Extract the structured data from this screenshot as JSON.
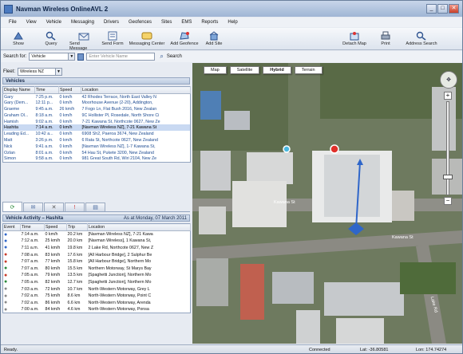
{
  "window": {
    "title": "Navman Wireless OnlineAVL 2"
  },
  "menu": [
    "File",
    "View",
    "Vehicle",
    "Messaging",
    "Drivers",
    "Geofences",
    "Sites",
    "EMS",
    "Reports",
    "Help"
  ],
  "toolbar": {
    "show": "Show",
    "query": "Query",
    "send_message": "Send Message",
    "send_form": "Send Form",
    "messaging_center": "Messaging Center",
    "add_geofence": "Add Geofence",
    "add_site": "Add Site",
    "detach_map": "Detach Map",
    "print": "Print",
    "address_search": "Address Search"
  },
  "search": {
    "label": "Search for:",
    "type": "Vehicle",
    "placeholder": "Enter Vehicle Name",
    "button": "Search"
  },
  "fleet": {
    "label": "Fleet:",
    "value": "Wireless NZ"
  },
  "vehicles": {
    "title": "Vehicles",
    "columns": [
      "Display Name",
      "Time",
      "Speed",
      "Location"
    ],
    "rows": [
      [
        "Gary",
        "7:25 p.m.",
        "0 km/h",
        "42 Rhodes Terrace, North East Valley N"
      ],
      [
        "Gary (Dem...",
        "12:11 p...",
        "0 km/h",
        "Moorhouse Avenue (2-20), Addington, "
      ],
      [
        "Graeme",
        "9:45 a.m.",
        "26 km/h",
        "7 Fogo Ln, Flat Bush 2016, New Zealan"
      ],
      [
        "Graham Ol...",
        "8:18 a.m.",
        "0 km/h",
        "9C Hollister Pl, Rosedale, North Shore Ci"
      ],
      [
        "Hamish",
        "9:02 a.m.",
        "0 km/h",
        "7-21 Kawana St, Northcote 0627, New Ze"
      ],
      [
        "Hashita",
        "7:14 a.m.",
        "0 km/h",
        "[Navman Wireless NZ], 7-21 Kawana St"
      ],
      [
        "Leading Ed...",
        "10:42 a...",
        "0 km/h",
        "6908 Sh2, Paeroa 3674, New Zealand"
      ],
      [
        "Matt",
        "3:26 p.m.",
        "0 km/h",
        "6 Rata St, Northcote 0627, New Zealand"
      ],
      [
        "Nick",
        "9:41 a.m.",
        "0 km/h",
        "[Navman Wireless NZ], 1-7 Kawana St,"
      ],
      [
        "Ozlan",
        "8:01 a.m.",
        "0 km/h",
        "54 Hau St, Pukete 3200, New Zealand"
      ],
      [
        "Simon",
        "9:58 a.m.",
        "0 km/h",
        "981 Great South Rd, Wiri 2104, New Ze"
      ]
    ]
  },
  "activity": {
    "title": "Vehicle Activity – Hashita",
    "as_at": "As at Monday, 07 March 2011",
    "columns": [
      "Event",
      "Time",
      "Speed",
      "Trip",
      "Location"
    ],
    "rows": [
      [
        "7:14 a.m.",
        "0 km/h",
        "20.2 km",
        "[Navman Wireless NZ], 7-21 Kawa"
      ],
      [
        "7:12 a.m.",
        "25 km/h",
        "20.0 km",
        "[Navman Wireless], 1 Kawana St,"
      ],
      [
        "7:11 a.m.",
        "41 km/h",
        "19.8 km",
        "2 Lake Rd, Northcote 0627, New Z"
      ],
      [
        "7:08 a.m.",
        "83 km/h",
        "17.6 km",
        "[All Harbour Bridge], 2 Sulphur Be"
      ],
      [
        "7:07 a.m.",
        "77 km/h",
        "15.8 km",
        "[All Harbour Bridge], Northern Mo"
      ],
      [
        "7:07 a.m.",
        "80 km/h",
        "15.5 km",
        "Northern Motorway, St Marys Bay"
      ],
      [
        "7:05 a.m.",
        "79 km/h",
        "13.5 km",
        "[Spaghetti Junction], Northern Mo"
      ],
      [
        "7:05 a.m.",
        "82 km/h",
        "12.7 km",
        "[Spaghetti Junction], Northern Mo"
      ],
      [
        "7:03 a.m.",
        "72 km/h",
        "10.7 km",
        "North-Western Motorway, Grey L"
      ],
      [
        "7:02 a.m.",
        "75 km/h",
        "8.6 km",
        "North-Western Motorway, Point C"
      ],
      [
        "7:02 a.m.",
        "86 km/h",
        "6.6 km",
        "North-Western Motorway, Arenda"
      ],
      [
        "7:00 a.m.",
        "84 km/h",
        "4.6 km",
        "North-Western Motorway, Ponsa"
      ]
    ]
  },
  "map": {
    "tabs": [
      "Map",
      "Satellite",
      "Hybrid",
      "Terrain"
    ],
    "streets": [
      "Kawana St",
      "Kawana St",
      "Lake Rd"
    ]
  },
  "status": {
    "left": "Ready.",
    "connection": "Connected",
    "lat": "Lat: -36.80581",
    "lon": "Lon: 174.74274"
  },
  "colors": {
    "selected_row": "#c9d9f2",
    "link_text": "#1d4b91",
    "chrome": "#e7ebf2"
  }
}
